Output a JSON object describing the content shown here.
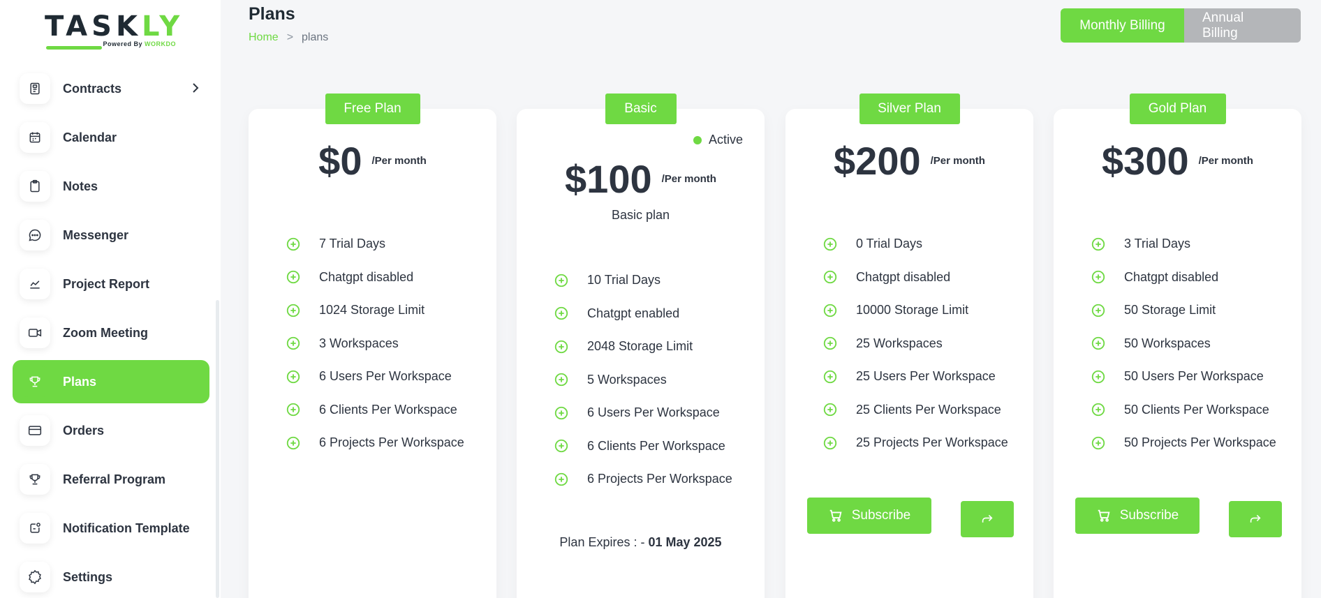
{
  "brand": {
    "name_part1": "TASK",
    "name_part2": "LY",
    "tagline_prefix": "Powered By",
    "tagline_brand": "WORKDO"
  },
  "sidebar": {
    "items": [
      {
        "label": "Contracts",
        "icon": "contract-icon",
        "has_chevron": true
      },
      {
        "label": "Calendar",
        "icon": "calendar-icon"
      },
      {
        "label": "Notes",
        "icon": "notes-icon"
      },
      {
        "label": "Messenger",
        "icon": "messenger-icon"
      },
      {
        "label": "Project Report",
        "icon": "chart-line-icon"
      },
      {
        "label": "Zoom Meeting",
        "icon": "video-icon"
      },
      {
        "label": "Plans",
        "icon": "trophy-icon",
        "active": true
      },
      {
        "label": "Orders",
        "icon": "credit-card-icon"
      },
      {
        "label": "Referral Program",
        "icon": "trophy-icon"
      },
      {
        "label": "Notification Template",
        "icon": "notification-icon"
      },
      {
        "label": "Settings",
        "icon": "gear-icon"
      }
    ]
  },
  "header": {
    "title": "Plans",
    "breadcrumb": {
      "home": "Home",
      "separator": ">",
      "current": "plans"
    },
    "billing": {
      "monthly": "Monthly Billing",
      "annual": "Annual Billing",
      "selected": "monthly"
    }
  },
  "accent_color": "#6fd943",
  "plans": [
    {
      "name": "Free Plan",
      "price": "$0",
      "period": "/Per month",
      "features": [
        "7 Trial Days",
        "Chatgpt disabled",
        "1024 Storage Limit",
        "3 Workspaces",
        "6 Users Per Workspace",
        "6 Clients Per Workspace",
        "6 Projects Per Workspace"
      ]
    },
    {
      "name": "Basic",
      "price": "$100",
      "period": "/Per month",
      "status": "Active",
      "description": "Basic plan",
      "features": [
        "10 Trial Days",
        "Chatgpt enabled",
        "2048 Storage Limit",
        "5 Workspaces",
        "6 Users Per Workspace",
        "6 Clients Per Workspace",
        "6 Projects Per Workspace"
      ],
      "expires_label": "Plan Expires : - ",
      "expires_date": "01 May 2025"
    },
    {
      "name": "Silver Plan",
      "price": "$200",
      "period": "/Per month",
      "features": [
        "0 Trial Days",
        "Chatgpt disabled",
        "10000 Storage Limit",
        "25 Workspaces",
        "25 Users Per Workspace",
        "25 Clients Per Workspace",
        "25 Projects Per Workspace"
      ],
      "subscribe_label": "Subscribe"
    },
    {
      "name": "Gold Plan",
      "price": "$300",
      "period": "/Per month",
      "features": [
        "3 Trial Days",
        "Chatgpt disabled",
        "50 Storage Limit",
        "50 Workspaces",
        "50 Users Per Workspace",
        "50 Clients Per Workspace",
        "50 Projects Per Workspace"
      ],
      "subscribe_label": "Subscribe"
    }
  ]
}
